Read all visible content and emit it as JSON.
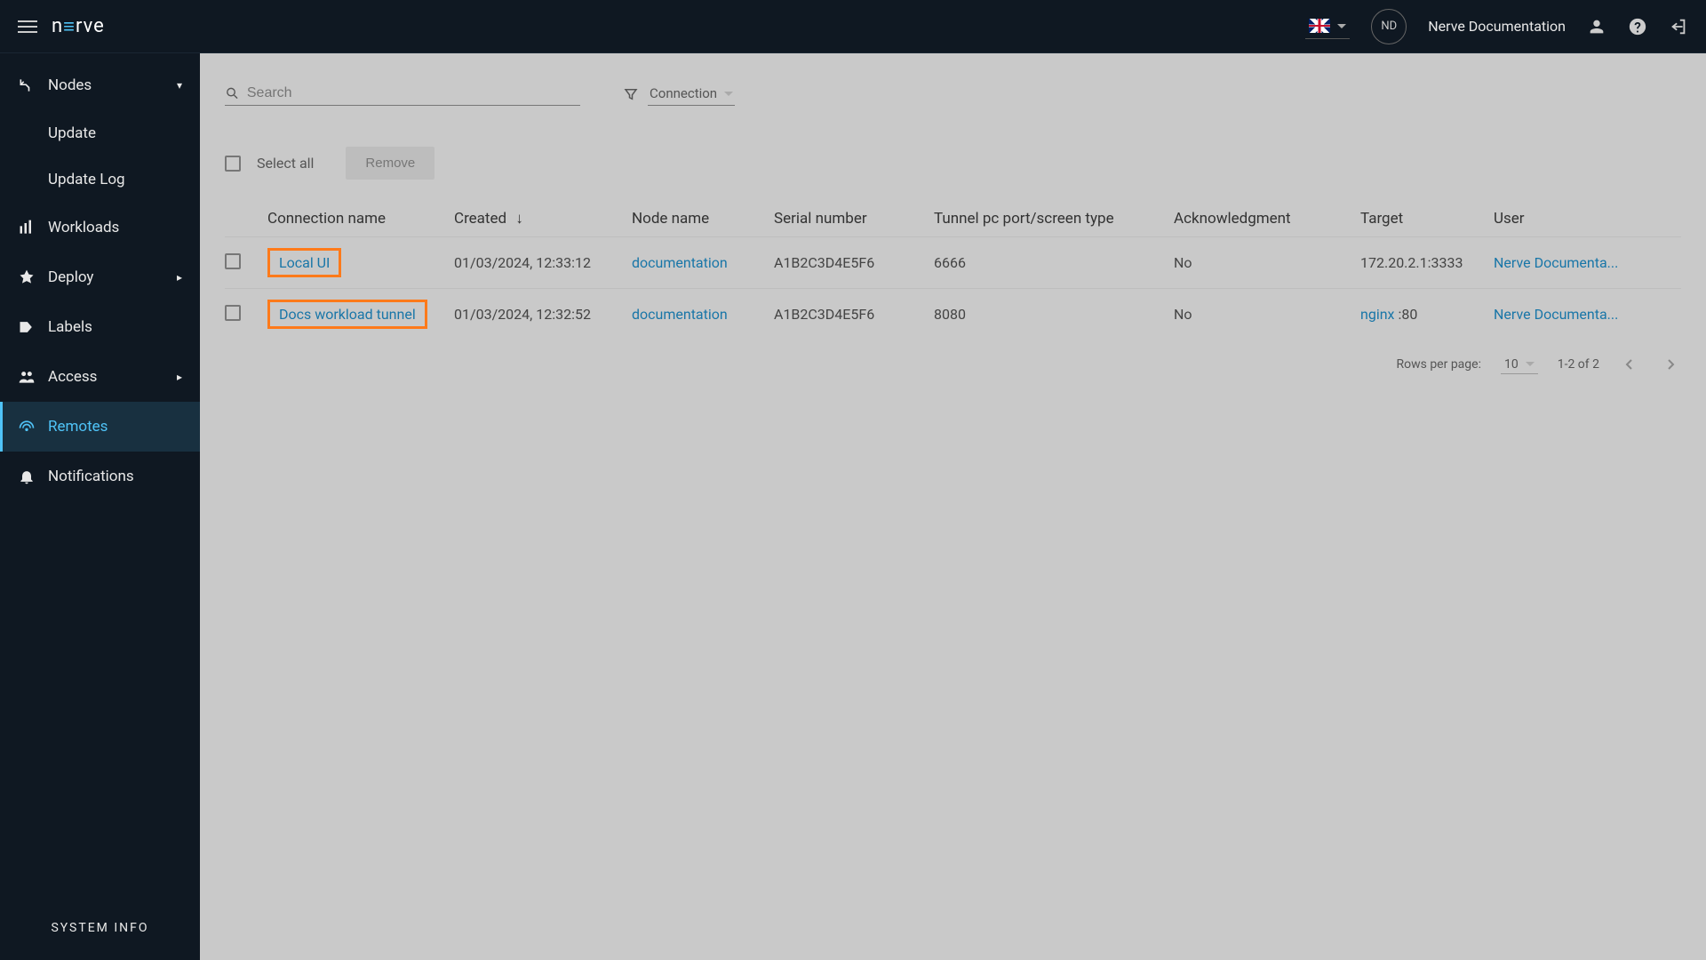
{
  "header": {
    "avatar_initials": "ND",
    "user_text": "Nerve Documentation",
    "logo_pre": "n",
    "logo_e": "≡",
    "logo_post": "rve"
  },
  "sidebar": {
    "items": [
      {
        "label": "Nodes"
      },
      {
        "label": "Update"
      },
      {
        "label": "Update Log"
      },
      {
        "label": "Workloads"
      },
      {
        "label": "Deploy"
      },
      {
        "label": "Labels"
      },
      {
        "label": "Access"
      },
      {
        "label": "Remotes"
      },
      {
        "label": "Notifications"
      }
    ],
    "system_info": "SYSTEM INFO"
  },
  "search": {
    "placeholder": "Search"
  },
  "filter": {
    "label": "Connection "
  },
  "select_all_label": "Select all",
  "remove_label": "Remove",
  "columns": {
    "conn": "Connection name",
    "created": "Created",
    "node": "Node name",
    "serial": "Serial number",
    "tunnel": "Tunnel pc port/screen type",
    "ack": "Acknowledgment",
    "target": "Target",
    "user": "User"
  },
  "rows": [
    {
      "conn": "Local UI",
      "created": "01/03/2024, 12:33:12",
      "node": "documentation",
      "serial": "A1B2C3D4E5F6",
      "tunnel": "6666",
      "ack": "No",
      "target_link": "",
      "target_suffix": "172.20.2.1:3333",
      "user": "Nerve Documenta..."
    },
    {
      "conn": "Docs workload tunnel",
      "created": "01/03/2024, 12:32:52",
      "node": "documentation",
      "serial": "A1B2C3D4E5F6",
      "tunnel": "8080",
      "ack": "No",
      "target_link": "nginx",
      "target_suffix": " :80",
      "user": "Nerve Documenta..."
    }
  ],
  "pagination": {
    "label": "Rows per page:",
    "per_page": "10",
    "range": "1-2 of 2"
  }
}
